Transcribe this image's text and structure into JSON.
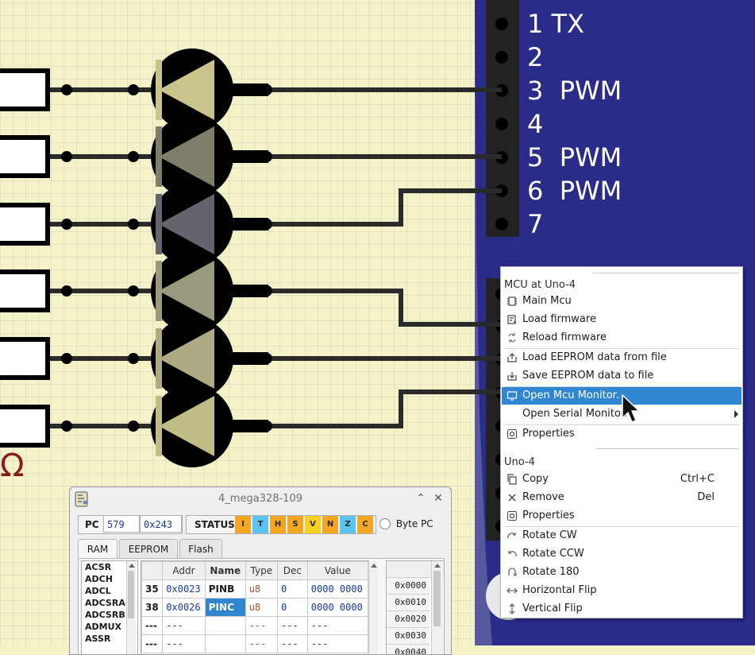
{
  "board": {
    "pins": [
      {
        "num": "1",
        "label": "TX"
      },
      {
        "num": "2",
        "label": ""
      },
      {
        "num": "3",
        "label": "PWM"
      },
      {
        "num": "4",
        "label": ""
      },
      {
        "num": "5",
        "label": "PWM"
      },
      {
        "num": "6",
        "label": "PWM"
      },
      {
        "num": "7",
        "label": ""
      }
    ],
    "board_color": "#2b2b8a",
    "resistor_symbol": "Ω",
    "led_colors": [
      "#c9c48c",
      "#7e7d6c",
      "#64636e",
      "#9c9a7e",
      "#aeab82",
      "#c0bd86"
    ]
  },
  "context_menu": {
    "section_mcu": "MCU at Uno-4",
    "items_mcu": [
      {
        "label": "Main Mcu",
        "icon": "chip-icon"
      },
      {
        "label": "Load firmware",
        "icon": "load-firmware-icon"
      },
      {
        "label": "Reload firmware",
        "icon": "reload-icon"
      }
    ],
    "items_eeprom": [
      {
        "label": "Load EEPROM data from file",
        "icon": "load-file-icon"
      },
      {
        "label": "Save EEPROM data to file",
        "icon": "save-file-icon"
      }
    ],
    "items_monitor": [
      {
        "label": "Open Mcu Monitor.",
        "icon": "monitor-icon",
        "selected": true
      },
      {
        "label": "Open Serial Monitor.",
        "icon": "",
        "submenu": true
      }
    ],
    "item_properties_mcu": {
      "label": "Properties",
      "icon": "gear-icon"
    },
    "section_component": "Uno-4",
    "items_component": [
      {
        "label": "Copy",
        "icon": "copy-icon",
        "shortcut": "Ctrl+C"
      },
      {
        "label": "Remove",
        "icon": "remove-icon",
        "shortcut": "Del"
      },
      {
        "label": "Properties",
        "icon": "gear-icon",
        "shortcut": ""
      }
    ],
    "items_transform": [
      {
        "label": "Rotate CW",
        "icon": "rotate-cw-icon"
      },
      {
        "label": "Rotate CCW",
        "icon": "rotate-ccw-icon"
      },
      {
        "label": "Rotate 180",
        "icon": "rotate-180-icon"
      },
      {
        "label": "Horizontal Flip",
        "icon": "hflip-icon"
      },
      {
        "label": "Vertical Flip",
        "icon": "vflip-icon"
      }
    ],
    "highlight_color": "#3086d0"
  },
  "monitor": {
    "title": "4_mega328-109",
    "pc_label": "PC",
    "pc_dec": "579",
    "pc_hex": "0x243",
    "status_label": "STATUS",
    "flags": [
      "I",
      "T",
      "H",
      "S",
      "V",
      "N",
      "Z",
      "C"
    ],
    "flag_colors": [
      "#f5a623",
      "#5bc4f0",
      "#f5a623",
      "#f5a623",
      "#f5d020",
      "#f5a623",
      "#5bc4f0",
      "#f5a623"
    ],
    "byte_pc_label": "Byte PC",
    "tabs": [
      "RAM",
      "EEPROM",
      "Flash"
    ],
    "active_tab": "RAM",
    "registers": [
      "ACSR",
      "ADCH",
      "ADCL",
      "ADCSRA",
      "ADCSRB",
      "ADMUX",
      "ASSR"
    ],
    "table_headers": [
      "",
      "Addr",
      "Name",
      "Type",
      "Dec",
      "Value"
    ],
    "rows": [
      {
        "num": "35",
        "addr": "0x0023",
        "name": "PINB",
        "type": "u8",
        "dec": "0",
        "value": "0000 0000",
        "highlight": false
      },
      {
        "num": "38",
        "addr": "0x0026",
        "name": "PINC",
        "type": "u8",
        "dec": "0",
        "value": "0000 0000",
        "highlight": true
      },
      {
        "num": "---",
        "addr": "---",
        "name": "",
        "type": "---",
        "dec": "---",
        "value": "---",
        "highlight": false
      },
      {
        "num": "---",
        "addr": "---",
        "name": "",
        "type": "---",
        "dec": "---",
        "value": "---",
        "highlight": false
      }
    ],
    "mem_addrs": [
      "0x0000",
      "0x0010",
      "0x0020",
      "0x0030",
      "0x0040"
    ]
  }
}
